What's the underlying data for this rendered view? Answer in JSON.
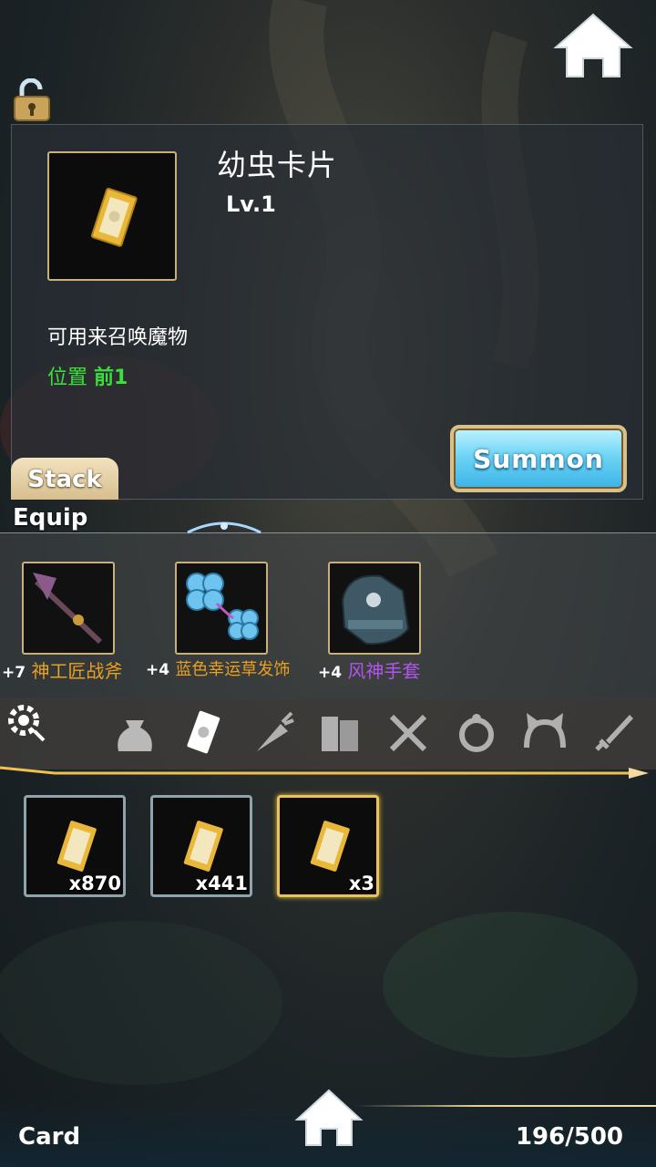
{
  "item": {
    "name": "幼虫卡片",
    "level": "Lv.1",
    "description": "可用来召唤魔物",
    "position_label": "位置",
    "position_value": "前1"
  },
  "buttons": {
    "summon": "Summon",
    "stack_tab": "Stack"
  },
  "equip": {
    "label": "Equip",
    "items": [
      {
        "plus": "+7",
        "name": "神工匠战斧",
        "color": "#e8a020",
        "icon": "axe-icon"
      },
      {
        "plus": "+4",
        "name": "蓝色幸运草发饰",
        "color": "#e8a020",
        "icon": "clover-hairpin-icon"
      },
      {
        "plus": "+4",
        "name": "风神手套",
        "color": "#b055ee",
        "icon": "gauntlet-icon"
      }
    ]
  },
  "categories": [
    "settings-gear-icon",
    "bag-icon",
    "card-icon",
    "carrot-icon",
    "books-icon",
    "fork-knife-icon",
    "ring-icon",
    "cat-ears-icon",
    "sword-icon"
  ],
  "inventory": [
    {
      "count": "x870",
      "selected": false
    },
    {
      "count": "x441",
      "selected": false
    },
    {
      "count": "x3",
      "selected": true
    }
  ],
  "footer": {
    "category": "Card",
    "capacity": "196/500"
  },
  "colors": {
    "position_green": "#39e03b",
    "frame_gold": "#c9b07a",
    "summon_blue": "#3bb2e6"
  }
}
